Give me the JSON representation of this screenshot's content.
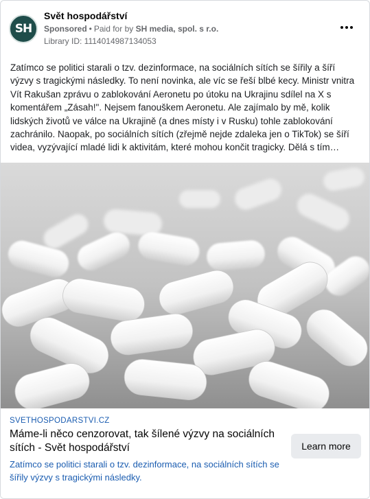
{
  "post": {
    "page_name": "Svět hospodářství",
    "avatar_initials": "SH",
    "sponsored_label": "Sponsored",
    "separator": "•",
    "paid_for_prefix": "Paid for by",
    "paid_for_by": "SH media, spol. s r.o.",
    "library_id": "Library ID: 1114014987134053",
    "more_icon": "more-options-icon",
    "body": "Zatímco se politici starali o tzv. dezinformace, na sociálních sítích se šířily a šíří výzvy s tragickými následky. To není novinka, ale víc se řeší blbé kecy. Ministr vnitra Vít Rakušan zprávu o zablokování Aeronetu po útoku na Ukrajinu sdílel na X s komentářem „Zásah!\". Nejsem fanouškem Aeronetu. Ale zajímalo by mě, kolik lidských životů ve válce na Ukrajině (a dnes místy i v Rusku) tohle zablokování zachránilo. Naopak, po sociálních sítích (zřejmě nejde zdaleka jen o TikTok) se šíří videa, vyzývající mladé lidi k aktivitám, které mohou končit tragicky. Dělá s tím…"
  },
  "link": {
    "domain": "SVETHOSPODARSTVI.CZ",
    "headline": "Máme-li něco cenzorovat, tak šílené výzvy na sociálních sítích - Svět hospodářství",
    "description": "Zatímco se politici starali o tzv. dezinformace, na sociálních sítích se šířily výzvy s tragickými následky.",
    "cta_label": "Learn more"
  },
  "colors": {
    "avatar_bg": "#1f4d4a",
    "link_blue": "#1a5cb0",
    "meta_grey": "#65676b"
  }
}
